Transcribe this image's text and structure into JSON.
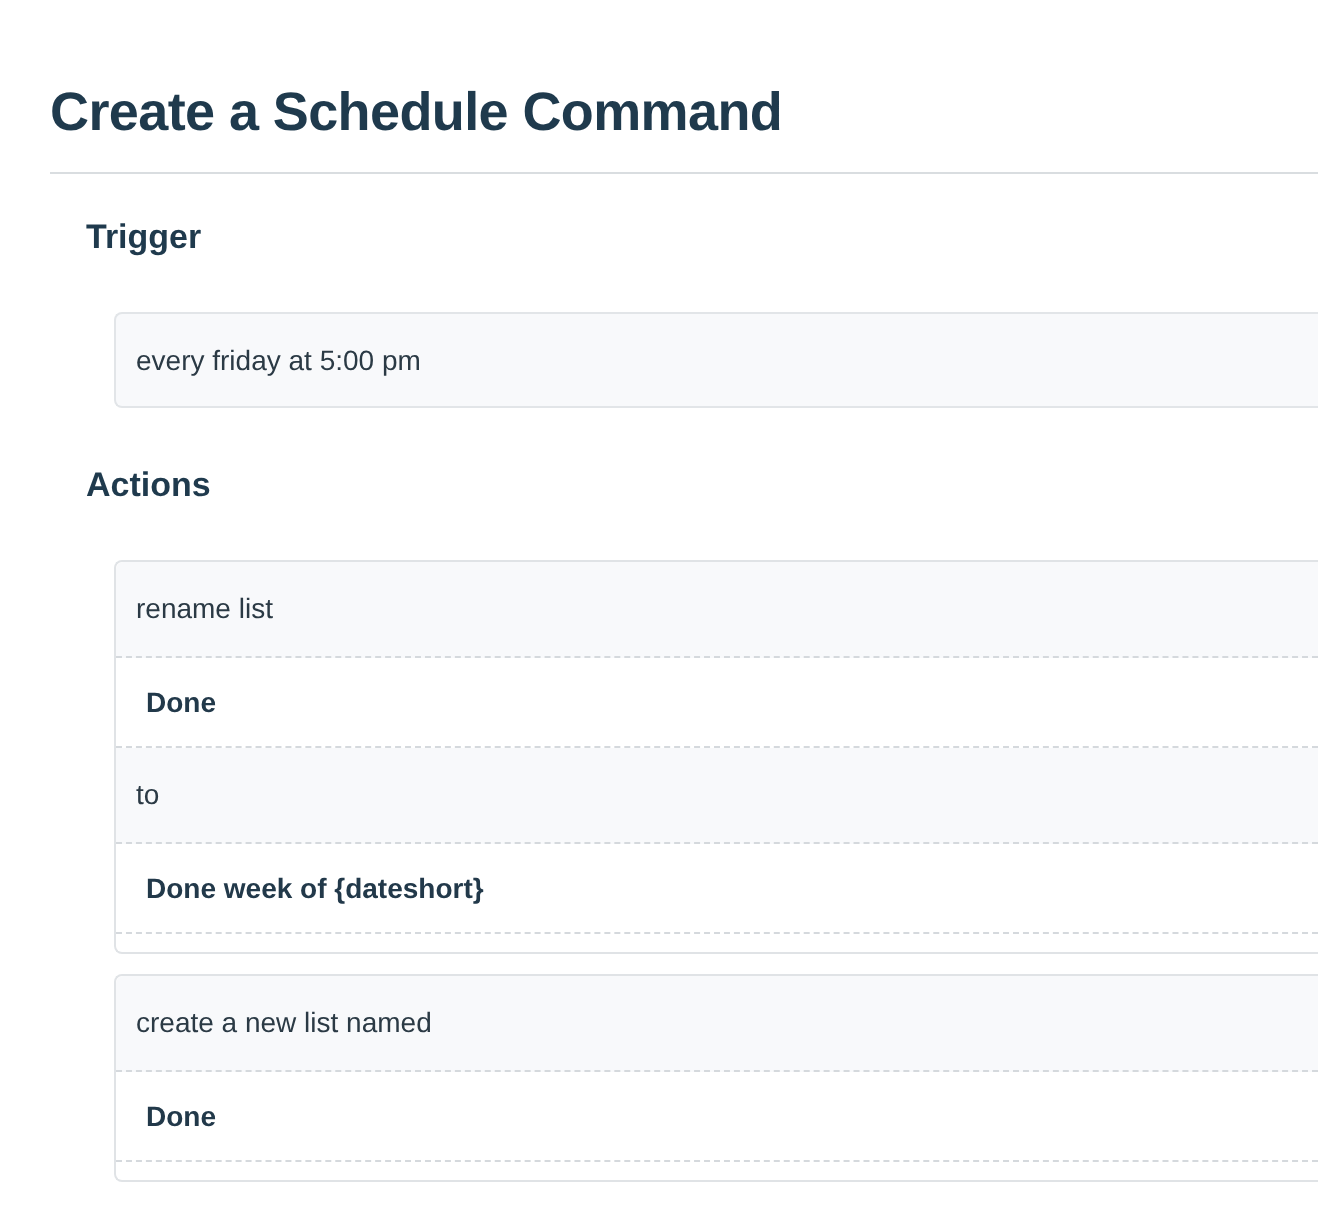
{
  "page": {
    "title": "Create a Schedule Command"
  },
  "trigger": {
    "heading": "Trigger",
    "value": "every friday at 5:00 pm"
  },
  "actions": {
    "heading": "Actions",
    "items": [
      {
        "rows": [
          {
            "kind": "label",
            "text": "rename list"
          },
          {
            "kind": "value",
            "text": "Done"
          },
          {
            "kind": "label",
            "text": "to"
          },
          {
            "kind": "value",
            "text": "Done week of {dateshort}"
          }
        ]
      },
      {
        "rows": [
          {
            "kind": "label",
            "text": "create a new list named"
          },
          {
            "kind": "value",
            "text": "Done"
          }
        ]
      }
    ]
  }
}
